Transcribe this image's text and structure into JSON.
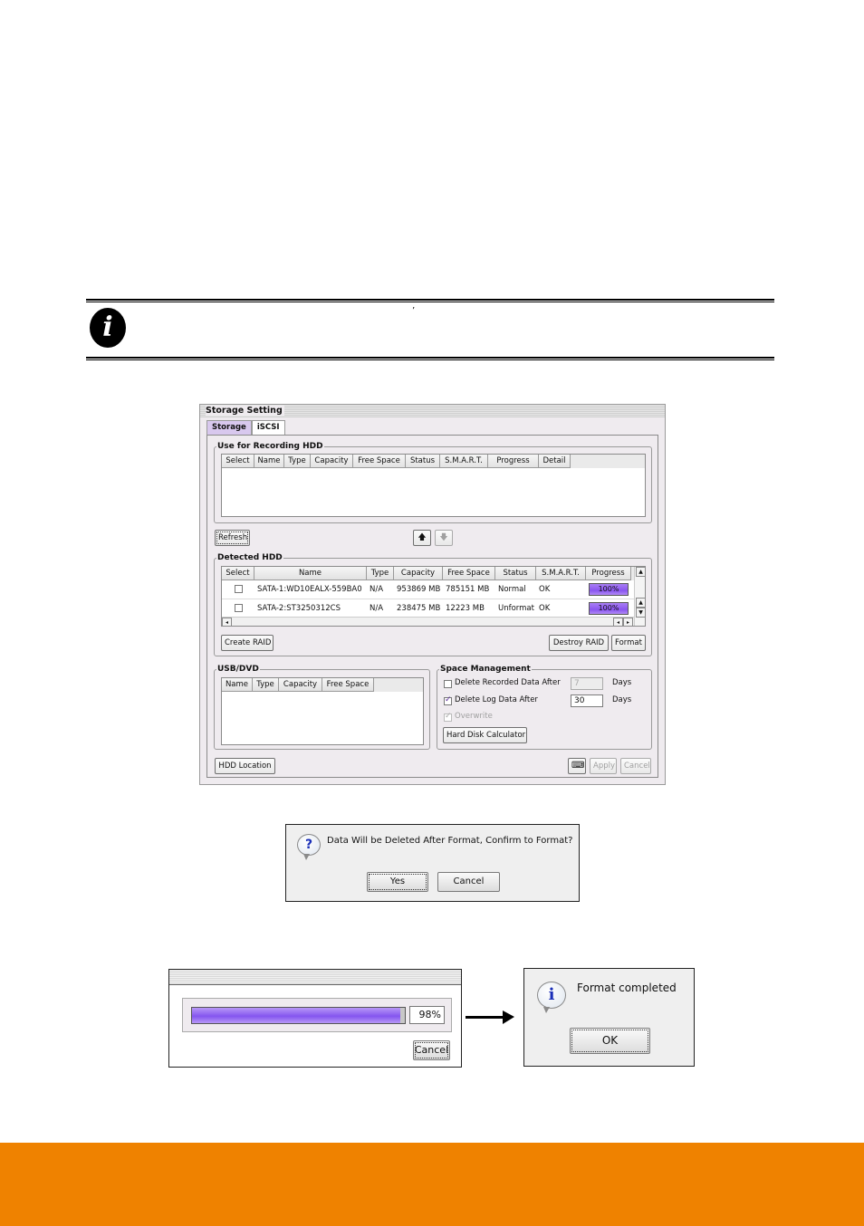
{
  "note": {
    "icon": "info-italic-i-icon",
    "apostrophe": "’"
  },
  "storage_window": {
    "title": "Storage Setting",
    "tabs": [
      {
        "label": "Storage",
        "active": true
      },
      {
        "label": "iSCSI",
        "active": false
      }
    ],
    "recording_hdd": {
      "legend": "Use for Recording HDD",
      "columns": [
        "Select",
        "Name",
        "Type",
        "Capacity",
        "Free Space",
        "Status",
        "S.M.A.R.T.",
        "Progress",
        "Detail"
      ],
      "rows": []
    },
    "refresh_label": "Refresh",
    "move_up_icon": "arrow-up-icon",
    "move_down_icon": "arrow-down-icon",
    "detected_hdd": {
      "legend": "Detected HDD",
      "columns": [
        "Select",
        "Name",
        "Type",
        "Capacity",
        "Free Space",
        "Status",
        "S.M.A.R.T.",
        "Progress"
      ],
      "rows": [
        {
          "selected": false,
          "name": "SATA-1:WD10EALX-559BA0",
          "type": "N/A",
          "capacity": "953869 MB",
          "free_space": "785151 MB",
          "status": "Normal",
          "smart": "OK",
          "progress": "100%"
        },
        {
          "selected": false,
          "name": "SATA-2:ST3250312CS",
          "type": "N/A",
          "capacity": "238475 MB",
          "free_space": "12223 MB",
          "status": "Unformat",
          "smart": "OK",
          "progress": "100%"
        }
      ],
      "create_raid_label": "Create RAID",
      "destroy_raid_label": "Destroy RAID",
      "format_label": "Format"
    },
    "usb_dvd": {
      "legend": "USB/DVD",
      "columns": [
        "Name",
        "Type",
        "Capacity",
        "Free Space"
      ],
      "rows": []
    },
    "space_management": {
      "legend": "Space Management",
      "delete_recorded_label": "Delete Recorded Data After",
      "delete_recorded_checked": false,
      "delete_recorded_value": "7",
      "delete_log_label": "Delete Log Data After",
      "delete_log_checked": true,
      "delete_log_value": "30",
      "days_label": "Days",
      "overwrite_label": "Overwrite",
      "overwrite_checked": true,
      "calculator_label": "Hard Disk Calculator"
    },
    "hdd_location_label": "HDD Location",
    "keyboard_icon": "keyboard-icon",
    "apply_label": "Apply",
    "cancel_label": "Cancel"
  },
  "confirm_dialog": {
    "icon": "question-bubble-icon",
    "icon_glyph": "?",
    "message": "Data Will be Deleted After Format, Confirm to Format?",
    "yes_label": "Yes",
    "cancel_label": "Cancel"
  },
  "progress_dialog": {
    "progress_percent": 98,
    "progress_text": "98%",
    "cancel_label": "Cancel"
  },
  "complete_dialog": {
    "icon": "info-bubble-icon",
    "icon_glyph": "i",
    "message": "Format completed",
    "ok_label": "OK"
  },
  "colors": {
    "footer_band": "#ef8200",
    "progress_fill": "#8a55ef",
    "active_tab": "#d8c8ee",
    "window_bg": "#efebef"
  }
}
